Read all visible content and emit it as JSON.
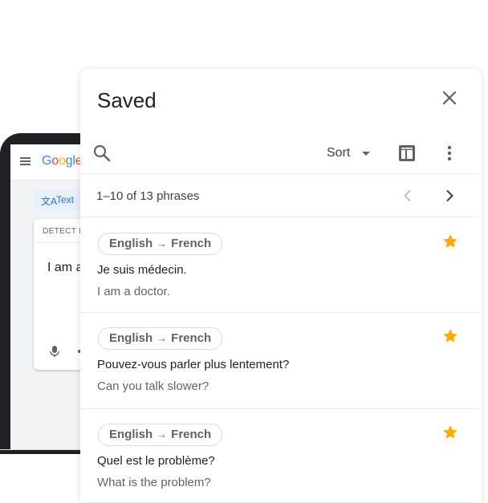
{
  "background": {
    "logo_text": "Google",
    "mode_chip": "Text",
    "detect_label": "DETECT L",
    "input_text": "I am a",
    "mic_icon": "mic-icon"
  },
  "panel": {
    "title": "Saved",
    "close_icon": "close-icon",
    "search_icon": "search-icon",
    "sort_label": "Sort",
    "sheets_icon": "sheets-icon",
    "more_icon": "more-vert-icon",
    "pager_text": "1–10 of 13 phrases",
    "star_color": "#f9ab00"
  },
  "phrases": [
    {
      "from_lang": "English",
      "arrow": "→",
      "to_lang": "French",
      "source": "Je suis médecin.",
      "translation": "I am a doctor."
    },
    {
      "from_lang": "English",
      "arrow": "→",
      "to_lang": "French",
      "source": "Pouvez-vous parler plus lentement?",
      "translation": "Can you talk slower?"
    },
    {
      "from_lang": "English",
      "arrow": "→",
      "to_lang": "French",
      "source": "Quel est le problème?",
      "translation": "What is the problem?"
    }
  ]
}
